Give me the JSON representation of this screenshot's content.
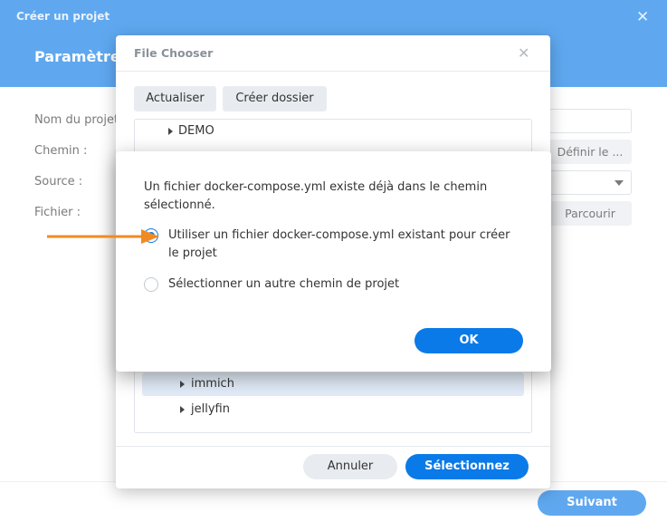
{
  "background_window": {
    "title": "Créer un projet",
    "subtitle": "Paramètres",
    "labels": [
      "Nom du projet",
      "Chemin :",
      "Source :",
      "Fichier :"
    ],
    "define_button": "Définir le ...",
    "browse_button": "Parcourir",
    "next_button": "Suivant"
  },
  "file_chooser": {
    "title": "File Chooser",
    "refresh_button": "Actualiser",
    "create_folder_button": "Créer dossier",
    "tree_items": [
      {
        "label": "DEMO",
        "selected": false
      },
      {
        "label": "immich",
        "selected": true
      },
      {
        "label": "jellyfin",
        "selected": false
      }
    ],
    "cancel_button": "Annuler",
    "select_button": "Sélectionnez"
  },
  "confirm_dialog": {
    "message": "Un fichier docker-compose.yml existe déjà dans le chemin sélectionné.",
    "options": [
      {
        "label": "Utiliser un fichier docker-compose.yml existant pour créer le projet",
        "checked": true
      },
      {
        "label": "Sélectionner un autre chemin de projet",
        "checked": false
      }
    ],
    "ok_button": "OK"
  },
  "colors": {
    "accent": "#0a7ae8",
    "annotation_arrow": "#f08a24"
  }
}
